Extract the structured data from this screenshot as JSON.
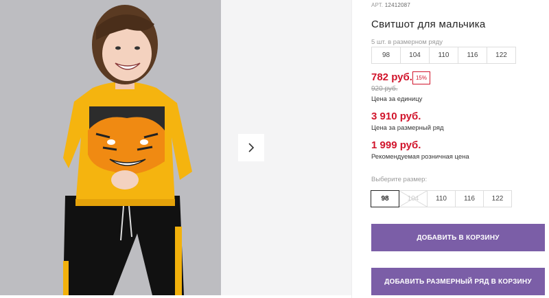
{
  "product": {
    "art_label": "АРТ.",
    "art_code": "12412087",
    "title": "Свитшот для мальчика",
    "pack_note": "5 шт. в размерном ряду",
    "pack_sizes": [
      "98",
      "104",
      "110",
      "116",
      "122"
    ]
  },
  "pricing": {
    "unit_price": "782 руб.",
    "discount": "15%",
    "old_price": "920 руб.",
    "unit_label": "Цена за единицу",
    "row_price": "3 910 руб.",
    "row_label": "Цена за размерный ряд",
    "rrp_price": "1 999 руб.",
    "rrp_label": "Рекомендуемая розничная цена"
  },
  "size_selector": {
    "label": "Выберите размер:",
    "options": [
      "98",
      "104",
      "110",
      "116",
      "122"
    ],
    "selected": "98",
    "unavailable": [
      "104"
    ]
  },
  "actions": {
    "add_to_cart": "ДОБАВИТЬ В КОРЗИНУ",
    "add_row_to_cart": "ДОБАВИТЬ РАЗМЕРНЫЙ РЯД В КОРЗИНУ"
  },
  "gallery": {
    "next_icon": "chevron-right-icon"
  },
  "colors": {
    "price_red": "#d1142b",
    "button_purple": "#7b5ea7",
    "sweatshirt_yellow": "#f5b40f"
  }
}
